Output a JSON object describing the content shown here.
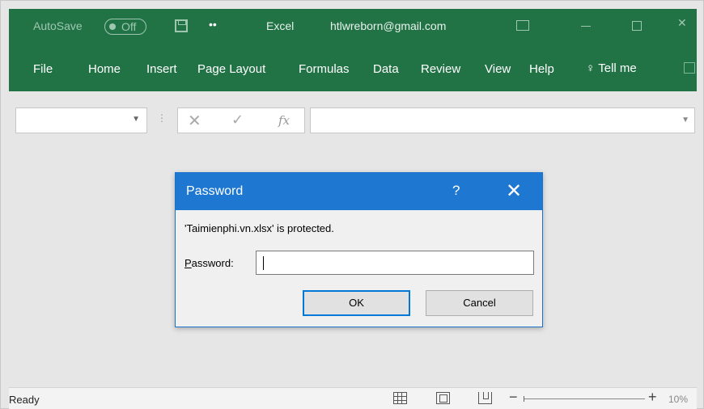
{
  "titlebar": {
    "autosave_label": "AutoSave",
    "autosave_state": "Off",
    "app_name": "Excel",
    "account": "htlwreborn@gmail.com",
    "qat_more": "••"
  },
  "ribbon": {
    "tabs": [
      "File",
      "Home",
      "Insert",
      "Page Layout",
      "Formulas",
      "Data",
      "Review",
      "View",
      "Help"
    ],
    "tell_me": "Tell me"
  },
  "formula_bar": {
    "name_box_value": "",
    "fx_label": "fx",
    "formula_value": ""
  },
  "dialog": {
    "title": "Password",
    "help": "?",
    "close": "✕",
    "message": "'Taimienphi.vn.xlsx' is protected.",
    "password_label_accel": "P",
    "password_label_rest": "assword:",
    "password_value": "",
    "ok_label": "OK",
    "cancel_label": "Cancel"
  },
  "statusbar": {
    "status": "Ready",
    "zoom_minus": "−",
    "zoom_plus": "+",
    "zoom_value": "10%",
    "zoom_percent": 10
  },
  "colors": {
    "excel_green": "#217346",
    "dialog_blue": "#1e78d1",
    "focus_blue": "#0078d7"
  }
}
